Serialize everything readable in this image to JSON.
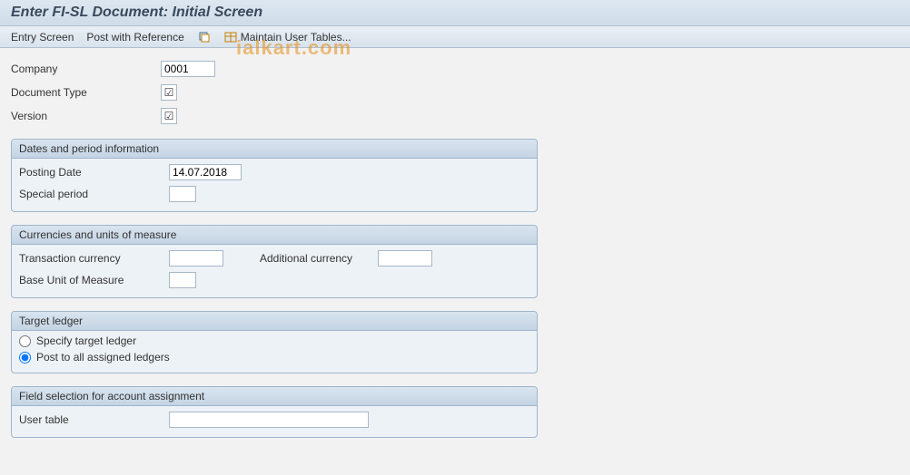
{
  "title": "Enter FI-SL Document: Initial Screen",
  "watermark": "ialkart.com",
  "toolbar": {
    "entry_screen": "Entry Screen",
    "post_with_reference": "Post with Reference",
    "maintain_user_tables": "Maintain User Tables..."
  },
  "top_fields": {
    "company_label": "Company",
    "company_value": "0001",
    "doc_type_label": "Document Type",
    "doc_type_checked": "☑",
    "version_label": "Version",
    "version_checked": "☑"
  },
  "group_dates": {
    "title": "Dates and period information",
    "posting_date_label": "Posting Date",
    "posting_date_value": "14.07.2018",
    "special_period_label": "Special period",
    "special_period_value": ""
  },
  "group_currencies": {
    "title": "Currencies and units of measure",
    "trans_curr_label": "Transaction currency",
    "trans_curr_value": "",
    "addl_curr_label": "Additional currency",
    "addl_curr_value": "",
    "base_uom_label": "Base Unit of Measure",
    "base_uom_value": ""
  },
  "group_target": {
    "title": "Target ledger",
    "specify_label": "Specify target ledger",
    "post_all_label": "Post to all assigned ledgers"
  },
  "group_field_sel": {
    "title": "Field selection for account assignment",
    "user_table_label": "User table",
    "user_table_value": ""
  }
}
